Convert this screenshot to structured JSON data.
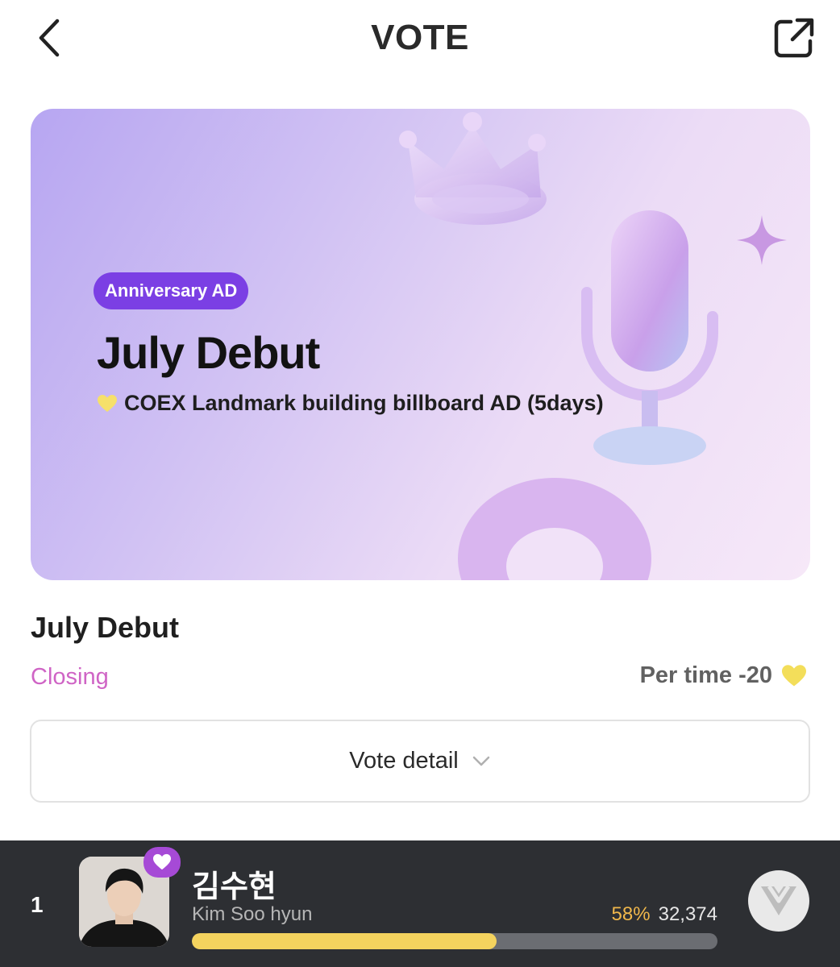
{
  "header": {
    "title": "VOTE",
    "back_icon": "chevron-left-icon",
    "share_icon": "share-external-icon"
  },
  "banner": {
    "badge": "Anniversary AD",
    "headline": "July Debut",
    "subline": "COEX Landmark building billboard AD (5days)",
    "subline_icon": "yellow-heart-icon",
    "colors": {
      "badge": "#7b3fe4",
      "gradient_start": "#b7a6f2",
      "gradient_end": "#f6e8f8"
    }
  },
  "vote": {
    "title": "July Debut",
    "status": "Closing",
    "per_time": "Per time -20",
    "per_time_icon": "yellow-heart-icon",
    "detail_button": "Vote detail",
    "colors": {
      "status": "#cf64c5"
    }
  },
  "ranking": {
    "rank": "1",
    "name_kr": "김수현",
    "name_en": "Kim Soo hyun",
    "percent": "58%",
    "progress": 0.58,
    "count": "32,374",
    "colors": {
      "bar": "#2d2f33",
      "progress": "#f4d35e",
      "percent": "#f0b74b",
      "favorite": "#a64ad6"
    }
  }
}
